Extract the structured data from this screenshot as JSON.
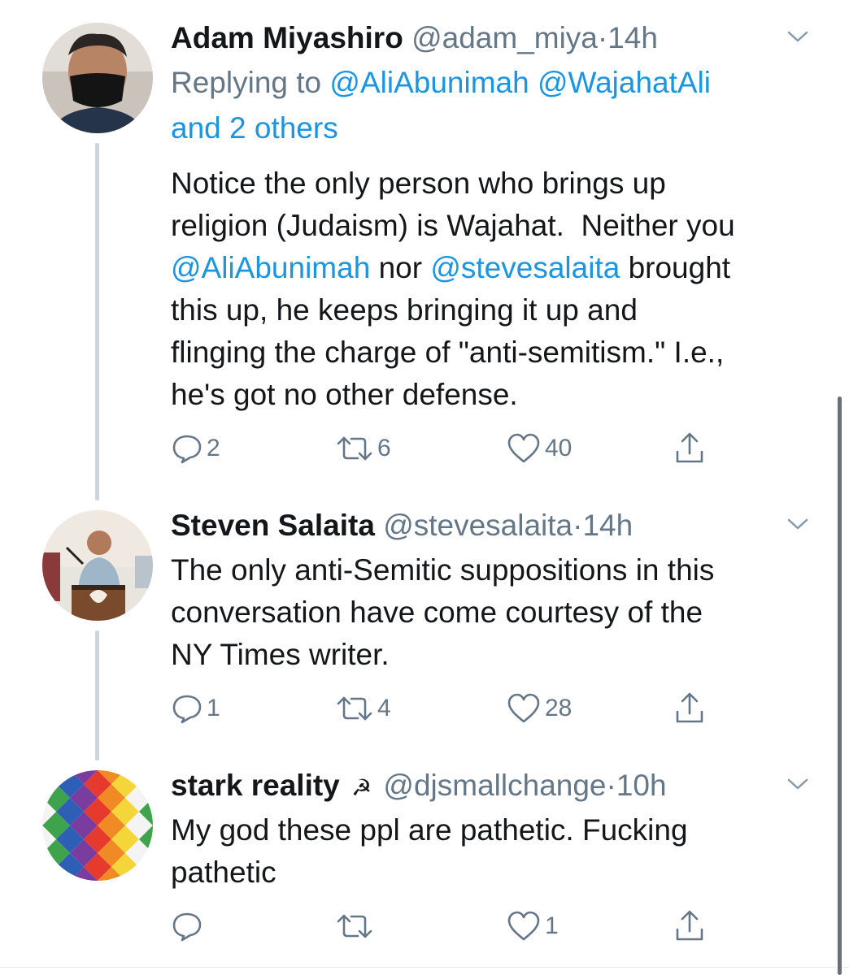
{
  "tweets": [
    {
      "name": "Adam Miyashiro",
      "handle": "@adam_miya",
      "dot": "·",
      "time": "14h",
      "reply_prefix": "Replying to",
      "reply_handles": [
        "@AliAbunimah",
        "@WajahatAli"
      ],
      "reply_others": "and 2 others",
      "body": {
        "line1": "Notice the only person who brings up",
        "line2": "religion (Judaism) is Wajahat.  Neither you",
        "mention1": "@AliAbunimah",
        "nor": " nor ",
        "mention2": "@stevesalaita",
        "brought": " brought",
        "line4": "this up, he keeps bringing it up and",
        "line5": "flinging the charge of \"anti-semitism.\" I.e.,",
        "line6": "he's got no other defense."
      },
      "reply_count": "2",
      "retweet_count": "6",
      "like_count": "40"
    },
    {
      "name": "Steven Salaita",
      "handle": "@stevesalaita",
      "dot": "·",
      "time": "14h",
      "body": {
        "line1": "The only anti-Semitic suppositions in this",
        "line2": "conversation have come courtesy of the",
        "line3": "NY Times writer."
      },
      "reply_count": "1",
      "retweet_count": "4",
      "like_count": "28"
    },
    {
      "name": "stark reality",
      "name_symbol": "☭",
      "handle": "@djsmallchange",
      "dot": "·",
      "time": "10h",
      "body": {
        "line1": "My god these ppl are pathetic. Fucking",
        "line2": "pathetic"
      },
      "reply_count": "",
      "retweet_count": "",
      "like_count": "1"
    }
  ],
  "icons": {
    "reply": "reply-icon",
    "retweet": "retweet-icon",
    "like": "heart-icon",
    "share": "share-icon",
    "caret": "chevron-down-icon"
  },
  "colors": {
    "link": "#1b95e0",
    "secondary_text": "#657786",
    "thread_line": "#ccd6dd"
  }
}
